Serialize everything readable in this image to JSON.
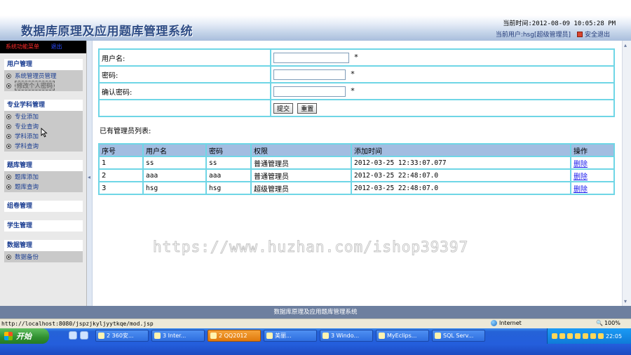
{
  "header": {
    "title": "数据库原理及应用题库管理系统",
    "clock": "当前时间:2012-08-09 10:05:28 PM",
    "current_user": "当前用户:hsg[超级管理员]",
    "logout_label": "安全退出"
  },
  "sidebar": {
    "topbar_label": "系统功能菜单",
    "topbar_exit": "退出",
    "groups": [
      {
        "head": "用户管理",
        "items": [
          "系统管理员管理",
          "修改个人密码"
        ]
      },
      {
        "head": "专业学科管理",
        "items": [
          "专业添加",
          "专业查询",
          "学科添加",
          "学科查询"
        ]
      },
      {
        "head": "题库管理",
        "items": [
          "题库添加",
          "题库查询"
        ]
      },
      {
        "head": "组卷管理",
        "items": []
      },
      {
        "head": "学生管理",
        "items": []
      },
      {
        "head": "数据管理",
        "items": [
          "数据备份"
        ]
      }
    ]
  },
  "form": {
    "username_label": "用户名:",
    "password_label": "密码:",
    "confirm_label": "确认密码:",
    "required_mark": "*",
    "submit_label": "提交",
    "reset_label": "重置"
  },
  "list": {
    "caption": "已有管理员列表:",
    "columns": [
      "序号",
      "用户名",
      "密码",
      "权限",
      "添加时间",
      "操作"
    ],
    "rows": [
      {
        "id": "1",
        "username": "ss",
        "password": "ss",
        "role": "普通管理员",
        "added": "2012-03-25 12:33:07.077",
        "action": "删除"
      },
      {
        "id": "2",
        "username": "aaa",
        "password": "aaa",
        "role": "普通管理员",
        "added": "2012-03-25 22:48:07.0",
        "action": "删除"
      },
      {
        "id": "3",
        "username": "hsg",
        "password": "hsg",
        "role": "超级管理员",
        "added": "2012-03-25 22:48:07.0",
        "action": "删除"
      }
    ]
  },
  "watermark": "https://www.huzhan.com/ishop39397",
  "footer": "数据库原理及应用题库管理系统",
  "statusbar": {
    "url": "http://localhost:8080/jspzjkyljyytkqe/mod.jsp",
    "zone": "Internet",
    "zoom": "100%"
  },
  "taskbar": {
    "start": "开始",
    "tasks": [
      "2 360安...",
      "3 Inter...",
      "2 QQ2012",
      "美丽...",
      "3 Windo...",
      "MyEclips...",
      "SQL Serv..."
    ],
    "active_task": 2,
    "clock": "22:05"
  }
}
